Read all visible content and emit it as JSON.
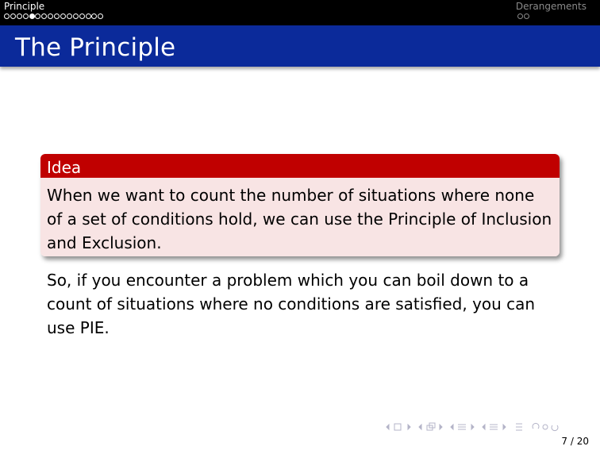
{
  "headline": {
    "left_section": "Principle",
    "right_section": "Derangements",
    "left_dots": [
      false,
      false,
      false,
      false,
      true,
      false,
      false,
      false,
      false,
      false,
      false,
      false,
      false,
      false,
      false,
      false
    ],
    "right_dots": [
      false,
      false
    ]
  },
  "frame": {
    "title": "The Principle"
  },
  "block": {
    "title": "Idea",
    "body": "When we want to count the number of situations where none of a set of conditions hold, we can use the Principle of Inclusion and Exclusion."
  },
  "paragraph": "So, if you encounter a problem which you can boil down to a count of situations where no conditions are satisfied, you can use PIE.",
  "navigation": {
    "page": "7 / 20"
  },
  "colors": {
    "headline_bg": "#000000",
    "title_bg": "#0b2a9a",
    "block_title_bg": "#c00000",
    "block_body_bg": "#f8e4e4"
  }
}
